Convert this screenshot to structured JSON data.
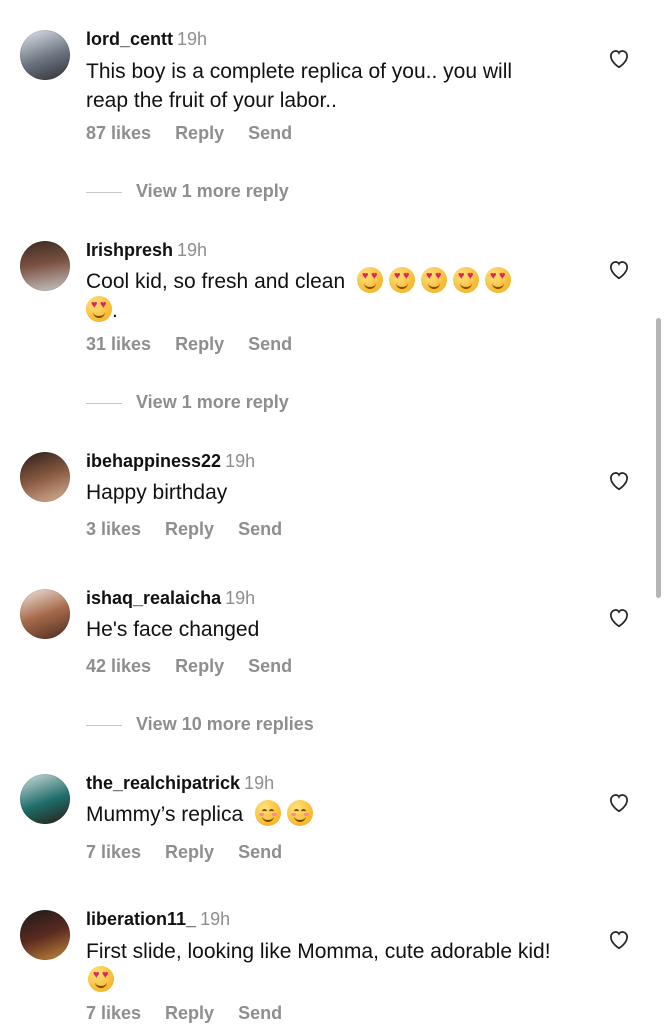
{
  "comments": [
    {
      "username": "lord_centt",
      "time": "19h",
      "text": "This boy is a complete replica of you.. you will reap the fruit of your labor..",
      "likes": "87 likes",
      "reply": "Reply",
      "send": "Send",
      "more_replies": "View 1 more reply"
    },
    {
      "username": "Irishpresh",
      "time": "19h",
      "text": "Cool kid, so fresh and clean",
      "text_suffix": ".",
      "likes": "31 likes",
      "reply": "Reply",
      "send": "Send",
      "more_replies": "View 1 more reply"
    },
    {
      "username": "ibehappiness22",
      "time": "19h",
      "text": "Happy birthday",
      "likes": "3 likes",
      "reply": "Reply",
      "send": "Send"
    },
    {
      "username": "ishaq_realaicha",
      "time": "19h",
      "text": "He's face changed",
      "likes": "42 likes",
      "reply": "Reply",
      "send": "Send",
      "more_replies": "View 10 more replies"
    },
    {
      "username": "the_realchipatrick",
      "time": "19h",
      "text": "Mummy’s replica",
      "likes": "7 likes",
      "reply": "Reply",
      "send": "Send"
    },
    {
      "username": "liberation11_",
      "time": "19h",
      "text": "First slide, looking like Momma, cute adorable kid!",
      "likes": "7 likes",
      "reply": "Reply",
      "send": "Send"
    }
  ],
  "icons": {
    "like": "heart-outline-icon",
    "emoji_heart": "smiling-face-with-heart-eyes-icon",
    "emoji_blush": "smiling-face-with-smiling-eyes-icon"
  },
  "colors": {
    "secondary_text": "#8e8e8e",
    "primary_text": "#111111"
  }
}
